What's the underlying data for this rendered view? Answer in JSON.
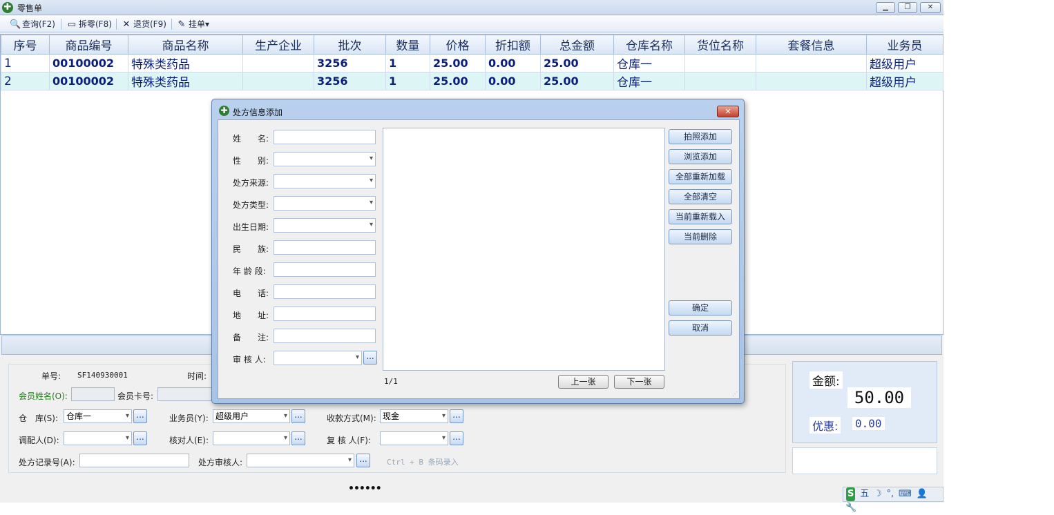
{
  "window": {
    "title": "零售单",
    "buttons": [
      "▁",
      "❐",
      "✕"
    ]
  },
  "toolbar": {
    "query": "查询(F2)",
    "split": "拆零(F8)",
    "return": "退货(F9)",
    "hold": "挂单▾"
  },
  "grid": {
    "columns": [
      "序号",
      "商品编号",
      "商品名称",
      "生产企业",
      "批次",
      "数量",
      "价格",
      "折扣额",
      "总金额",
      "仓库名称",
      "货位名称",
      "套餐信息",
      "业务员"
    ],
    "rows": [
      {
        "seq": "1",
        "code": "00100002",
        "name": "特殊类药品",
        "maker": "",
        "batch": "3256",
        "qty": "1",
        "price": "25.00",
        "discount": "0.00",
        "total": "25.00",
        "warehouse": "仓库一",
        "location": "",
        "package": "",
        "salesman": "超级用户"
      },
      {
        "seq": "2",
        "code": "00100002",
        "name": "特殊类药品",
        "maker": "",
        "batch": "3256",
        "qty": "1",
        "price": "25.00",
        "discount": "0.00",
        "total": "25.00",
        "warehouse": "仓库一",
        "location": "",
        "package": "",
        "salesman": "超级用户"
      }
    ]
  },
  "form": {
    "order_no_label": "单号:",
    "order_no": "SF140930001",
    "time_label": "时间:",
    "member_name_label": "会员姓名(O):",
    "member_card_label": "会员卡号:",
    "warehouse_label": "仓　库(S):",
    "warehouse_value": "仓库一",
    "salesman_label": "业务员(Y):",
    "salesman_value": "超级用户",
    "payment_label": "收款方式(M):",
    "payment_value": "现金",
    "dispenser_label": "调配人(D):",
    "checker_label": "核对人(E):",
    "reviewer_label": "复 核 人(F):",
    "rx_record_label": "处方记录号(A):",
    "rx_reviewer_label": "处方审核人:",
    "barcode_hint": "Ctrl + B 条码录入",
    "dots": "..."
  },
  "amount": {
    "label": "金额:",
    "value": "50.00",
    "discount_label": "优惠:",
    "discount_value": "0.00"
  },
  "statusbar": {
    "dots": "••••••",
    "tray": [
      "S",
      "五",
      "☽",
      "°,",
      "⌨",
      "👤",
      "🔧"
    ]
  },
  "dialog": {
    "title": "处方信息添加",
    "close": "✕",
    "fields": {
      "name": "姓　　名:",
      "gender": "性　　别:",
      "rx_source": "处方来源:",
      "rx_type": "处方类型:",
      "birth_date": "出生日期:",
      "ethnicity": "民　　族:",
      "age_group": "年 龄 段:",
      "phone": "电　　话:",
      "address": "地　　址:",
      "remark": "备　　注:",
      "auditor": "审 核 人:"
    },
    "buttons": {
      "photo_add": "拍照添加",
      "browse_add": "浏览添加",
      "reload_all": "全部重新加载",
      "clear_all": "全部清空",
      "reload_current": "当前重新载入",
      "delete_current": "当前删除",
      "confirm": "确定",
      "cancel": "取消",
      "prev": "上一张",
      "next": "下一张"
    },
    "page_indicator": "1/1"
  }
}
